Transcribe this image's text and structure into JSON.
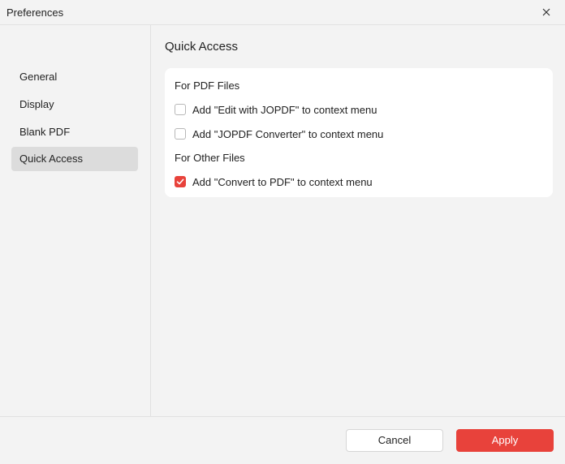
{
  "window": {
    "title": "Preferences",
    "close_icon": "close-icon"
  },
  "sidebar": {
    "items": [
      {
        "label": "General",
        "active": false
      },
      {
        "label": "Display",
        "active": false
      },
      {
        "label": "Blank PDF",
        "active": false
      },
      {
        "label": "Quick Access",
        "active": true
      }
    ]
  },
  "main": {
    "title": "Quick Access",
    "groups": [
      {
        "label": "For PDF Files",
        "options": [
          {
            "label": "Add \"Edit with JOPDF\" to context menu",
            "checked": false
          },
          {
            "label": "Add \"JOPDF Converter\" to context menu",
            "checked": false
          }
        ]
      },
      {
        "label": "For Other Files",
        "options": [
          {
            "label": "Add \"Convert to PDF\" to context menu",
            "checked": true
          }
        ]
      }
    ]
  },
  "footer": {
    "cancel_label": "Cancel",
    "apply_label": "Apply"
  },
  "colors": {
    "accent": "#e8423b",
    "sidebar_active": "#dcdcdc",
    "background": "#f3f3f3",
    "card": "#ffffff"
  }
}
